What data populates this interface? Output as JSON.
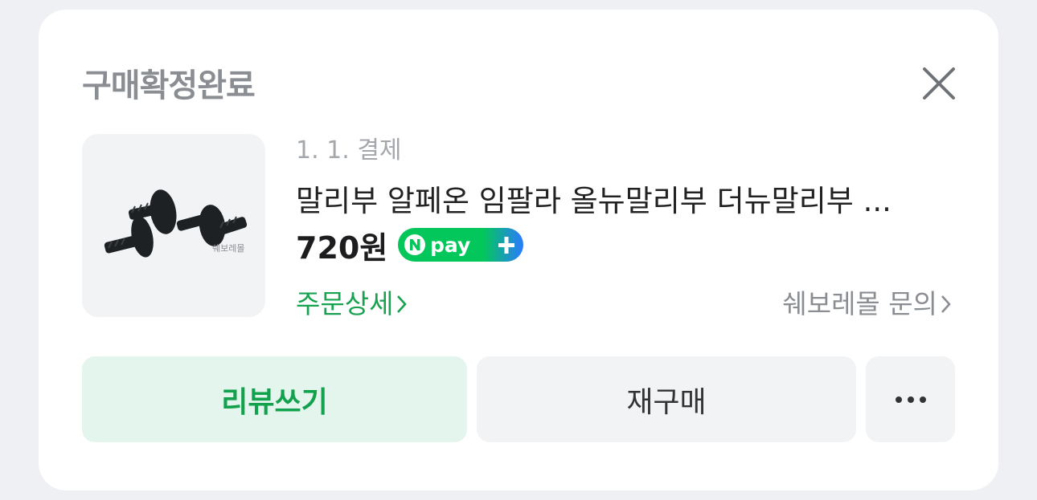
{
  "header": {
    "title": "구매확정완료"
  },
  "order": {
    "date": "1. 1. 결제",
    "product_name": "말리부 알페온 임팔라 올뉴말리부 더뉴말리부 ...",
    "price": "720원",
    "thumbnail_watermark": "쉐보레몰",
    "order_detail_link": "주문상세",
    "store_inquiry_link": "쉐보레몰 문의"
  },
  "actions": {
    "review": "리뷰쓰기",
    "rebuy": "재구매"
  },
  "colors": {
    "brand_green": "#12a14c",
    "npay_green": "#03c75a",
    "npay_blue": "#2b7bff"
  }
}
